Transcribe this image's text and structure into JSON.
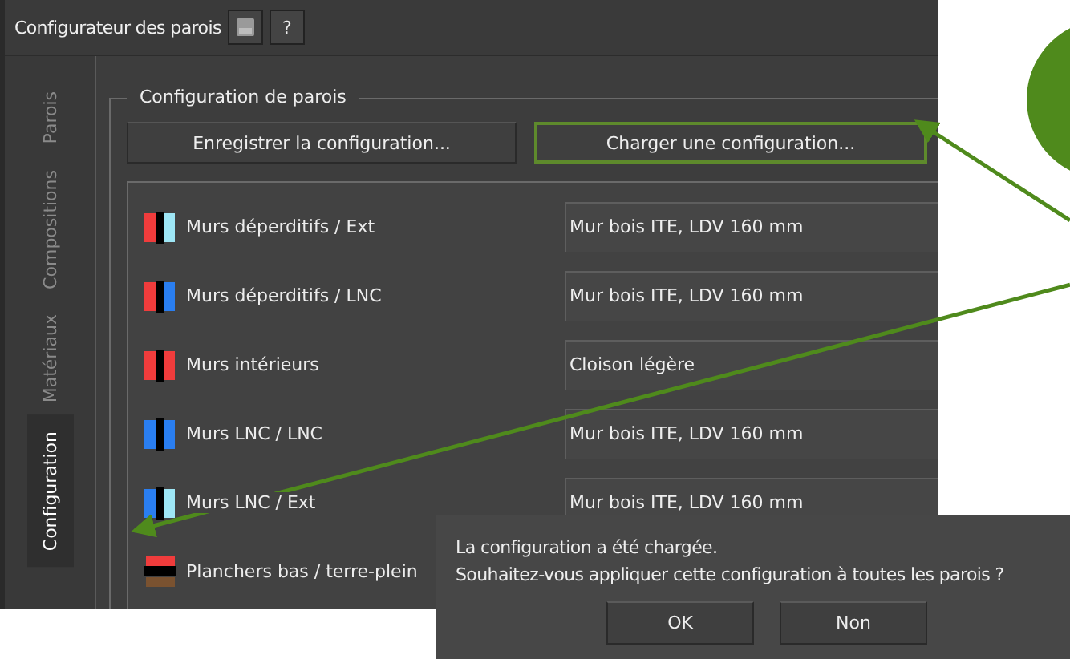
{
  "window": {
    "title": "Configurateur des parois",
    "title_buttons": [
      {
        "kind": "save"
      },
      {
        "kind": "text",
        "label": "?"
      }
    ]
  },
  "tabs": [
    {
      "label": "Parois",
      "selected": false
    },
    {
      "label": "Compositions",
      "selected": false
    },
    {
      "label": "Matériaux",
      "selected": false
    },
    {
      "label": "Configuration",
      "selected": true
    }
  ],
  "group": {
    "title": "Configuration de parois",
    "buttons": [
      {
        "label": "Enregistrer la configuration...",
        "focused": false
      },
      {
        "label": "Charger une configuration...",
        "focused": true
      }
    ],
    "rows": [
      {
        "kind": "wall",
        "stripes": [
          {
            "color": "#f03c3c"
          },
          {
            "color": "#9ee6f5"
          }
        ],
        "label": "Murs déperditifs / Ext",
        "value": "Mur bois ITE, LDV 160 mm"
      },
      {
        "kind": "wall",
        "stripes": [
          {
            "color": "#f03c3c"
          },
          {
            "color": "#2a7ef0"
          }
        ],
        "label": "Murs déperditifs / LNC",
        "value": "Mur bois ITE, LDV 160 mm"
      },
      {
        "kind": "wall",
        "stripes": [
          {
            "color": "#f03c3c"
          },
          {
            "color": "#f03c3c"
          }
        ],
        "label": "Murs intérieurs",
        "value": "Cloison légère"
      },
      {
        "kind": "wall",
        "stripes": [
          {
            "color": "#2a7ef0"
          },
          {
            "color": "#2a7ef0"
          }
        ],
        "label": "Murs LNC / LNC",
        "value": "Mur bois ITE, LDV 160 mm"
      },
      {
        "kind": "wall",
        "stripes": [
          {
            "color": "#2a7ef0"
          },
          {
            "color": "#9ee6f5"
          }
        ],
        "label": "Murs LNC / Ext",
        "value": "Mur bois ITE, LDV 160 mm"
      },
      {
        "kind": "floor",
        "stripes": [
          {
            "color": "#f03c3c"
          },
          {
            "color": "#7a5230"
          }
        ],
        "label": "Planchers bas / terre-plein"
      }
    ]
  },
  "dialog": {
    "lines": [
      "La configuration a été chargée.",
      "Souhaitez-vous appliquer cette configuration à toutes les parois ?"
    ],
    "buttons": [
      "OK",
      "Non"
    ]
  }
}
